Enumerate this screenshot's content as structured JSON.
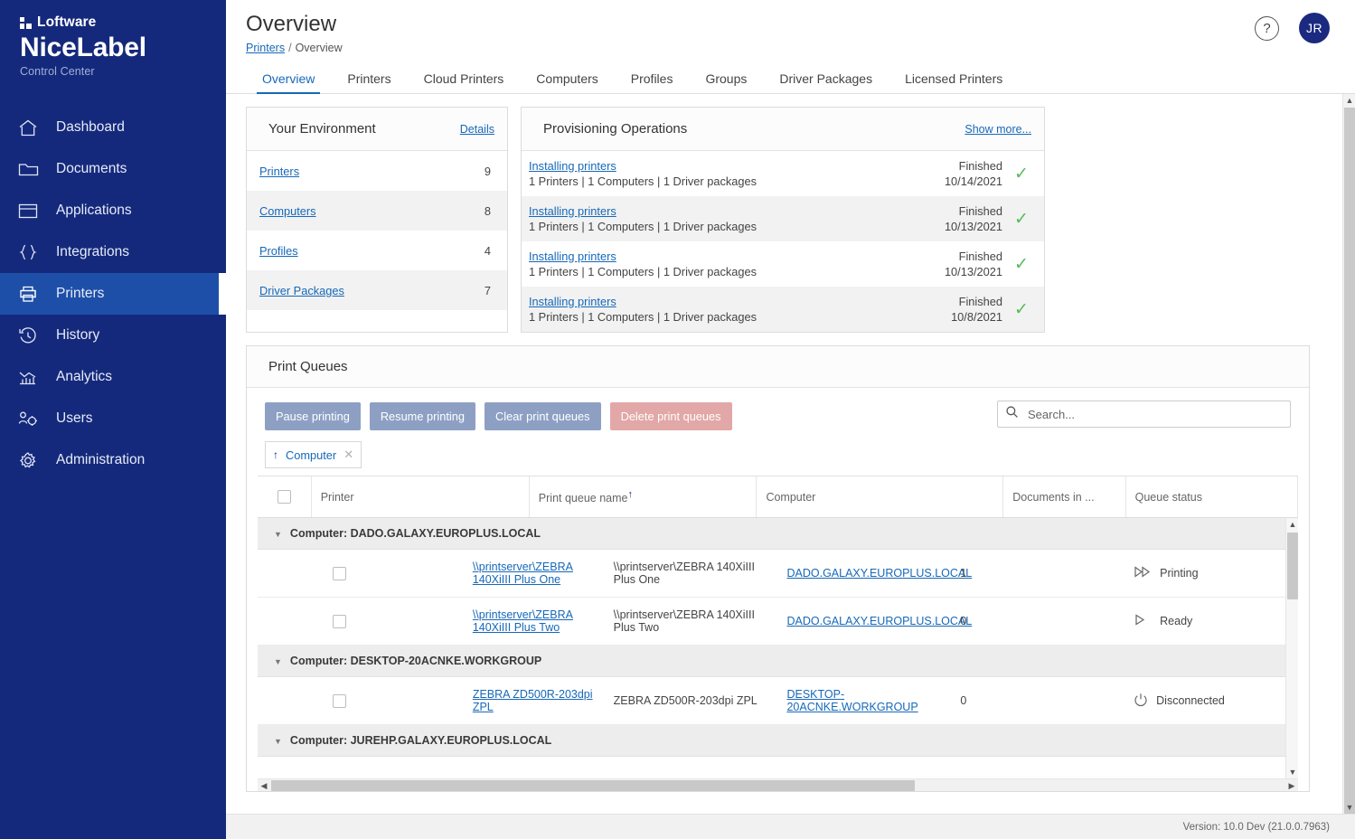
{
  "brand": {
    "company": "Loftware",
    "product": "NiceLabel",
    "subtitle": "Control Center"
  },
  "sidebar": {
    "items": [
      {
        "label": "Dashboard",
        "icon": "home-icon",
        "active": false
      },
      {
        "label": "Documents",
        "icon": "folder-icon",
        "active": false
      },
      {
        "label": "Applications",
        "icon": "window-icon",
        "active": false
      },
      {
        "label": "Integrations",
        "icon": "braces-icon",
        "active": false
      },
      {
        "label": "Printers",
        "icon": "printer-icon",
        "active": true
      },
      {
        "label": "History",
        "icon": "history-clock-icon",
        "active": false
      },
      {
        "label": "Analytics",
        "icon": "bar-chart-icon",
        "active": false
      },
      {
        "label": "Users",
        "icon": "users-gear-icon",
        "active": false
      },
      {
        "label": "Administration",
        "icon": "gear-icon",
        "active": false
      }
    ]
  },
  "header": {
    "title": "Overview",
    "breadcrumb": {
      "parent": "Printers",
      "separator": "/",
      "current": "Overview"
    },
    "help_icon": "question-mark-circle-icon",
    "avatar_initials": "JR"
  },
  "tabs": [
    {
      "label": "Overview",
      "active": true
    },
    {
      "label": "Printers",
      "active": false
    },
    {
      "label": "Cloud Printers",
      "active": false
    },
    {
      "label": "Computers",
      "active": false
    },
    {
      "label": "Profiles",
      "active": false
    },
    {
      "label": "Groups",
      "active": false
    },
    {
      "label": "Driver Packages",
      "active": false
    },
    {
      "label": "Licensed Printers",
      "active": false
    }
  ],
  "environment": {
    "title": "Your Environment",
    "details_link": "Details",
    "rows": [
      {
        "label": "Printers",
        "count": "9"
      },
      {
        "label": "Computers",
        "count": "8"
      },
      {
        "label": "Profiles",
        "count": "4"
      },
      {
        "label": "Driver Packages",
        "count": "7"
      }
    ]
  },
  "provisioning": {
    "title": "Provisioning Operations",
    "show_more_link": "Show more...",
    "rows": [
      {
        "name": "Installing printers",
        "detail": "1 Printers | 1 Computers | 1 Driver packages",
        "status": "Finished",
        "date": "10/14/2021",
        "icon": "check-icon"
      },
      {
        "name": "Installing printers",
        "detail": "1 Printers | 1 Computers | 1 Driver packages",
        "status": "Finished",
        "date": "10/13/2021",
        "icon": "check-icon"
      },
      {
        "name": "Installing printers",
        "detail": "1 Printers | 1 Computers | 1 Driver packages",
        "status": "Finished",
        "date": "10/13/2021",
        "icon": "check-icon"
      },
      {
        "name": "Installing printers",
        "detail": "1 Printers | 1 Computers | 1 Driver packages",
        "status": "Finished",
        "date": "10/8/2021",
        "icon": "check-icon"
      }
    ]
  },
  "print_queues": {
    "title": "Print Queues",
    "buttons": {
      "pause": "Pause printing",
      "resume": "Resume printing",
      "clear": "Clear print queues",
      "delete": "Delete print queues"
    },
    "search_placeholder": "Search...",
    "group_chip": {
      "sort_icon": "sort-ascending-icon",
      "label": "Computer",
      "remove_icon": "close-icon"
    },
    "columns": {
      "printer": "Printer",
      "queue_name": "Print queue name",
      "computer": "Computer",
      "documents": "Documents in ...",
      "status": "Queue status"
    },
    "groups": [
      {
        "header": "Computer: DADO.GALAXY.EUROPLUS.LOCAL",
        "rows": [
          {
            "printer": "\\\\printserver\\ZEBRA 140XiIII Plus One",
            "queue_name": "\\\\printserver\\ZEBRA 140XiIII Plus One",
            "computer": "DADO.GALAXY.EUROPLUS.LOCAL",
            "documents": "1",
            "status": "Printing",
            "status_icon": "double-triangle-icon"
          },
          {
            "printer": "\\\\printserver\\ZEBRA 140XiIII Plus Two",
            "queue_name": "\\\\printserver\\ZEBRA 140XiIII Plus Two",
            "computer": "DADO.GALAXY.EUROPLUS.LOCAL",
            "documents": "0",
            "status": "Ready",
            "status_icon": "triangle-icon"
          }
        ]
      },
      {
        "header": "Computer: DESKTOP-20ACNKE.WORKGROUP",
        "rows": [
          {
            "printer": "ZEBRA ZD500R-203dpi ZPL",
            "queue_name": "ZEBRA ZD500R-203dpi ZPL",
            "computer": "DESKTOP-20ACNKE.WORKGROUP",
            "documents": "0",
            "status": "Disconnected",
            "status_icon": "power-icon"
          }
        ]
      },
      {
        "header": "Computer: JUREHP.GALAXY.EUROPLUS.LOCAL",
        "rows": []
      }
    ]
  },
  "footer": {
    "version": "Version: 10.0 Dev (21.0.0.7963)"
  },
  "colors": {
    "sidebar_bg": "#15297c",
    "sidebar_active": "#1e4fa8",
    "link_blue": "#1668b8",
    "accent_blue": "#8da0c4",
    "danger_red": "#e2a7a7",
    "success_green": "#5bb85b"
  }
}
